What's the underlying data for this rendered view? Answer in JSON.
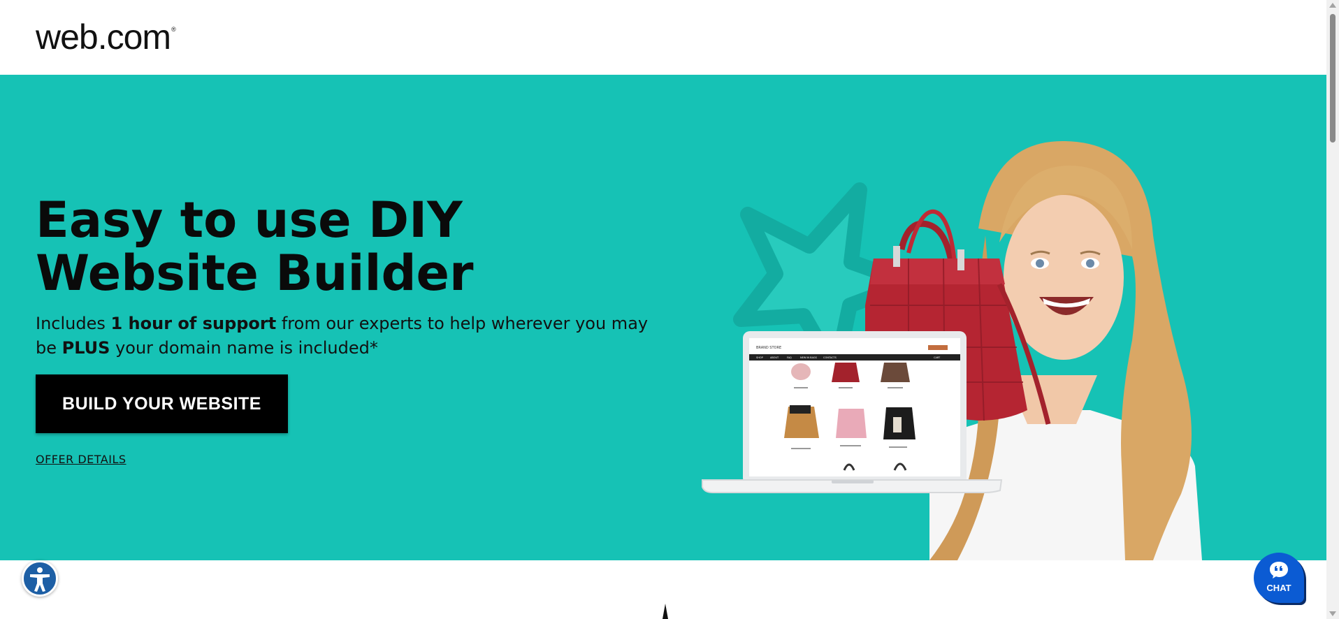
{
  "header": {
    "logo_text": "web.com",
    "logo_mark": "®"
  },
  "hero": {
    "background_color": "#16c2b5",
    "headline_line1": "Easy to use DIY",
    "headline_line2": "Website Builder",
    "subtext": {
      "part1": "Includes ",
      "bold1": "1 hour of support",
      "part2": " from our experts to help wherever you may be ",
      "bold2": "PLUS",
      "part3": " your domain name is included*"
    },
    "cta_label": "BUILD YOUR WEBSITE",
    "offer_link_label": "OFFER DETAILS",
    "mockup": {
      "store_name": "BRAND STORE",
      "nav_items": [
        "SHOP",
        "ABOUT",
        "FAQ",
        "NEW IN BAGS",
        "CONTACTS"
      ],
      "cart_label": "CART"
    }
  },
  "widgets": {
    "accessibility_icon": "accessibility-icon",
    "chat_label": "CHAT",
    "chat_icon": "chat-bubble-icon"
  },
  "colors": {
    "brand_teal": "#16c2b5",
    "cta_black": "#000000",
    "chat_blue": "#0b5bd3",
    "accessibility_blue": "#1d5fa5"
  }
}
